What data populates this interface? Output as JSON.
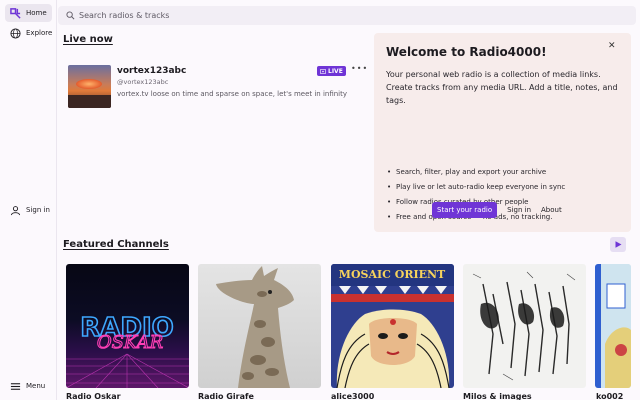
{
  "sidebar": {
    "home_label": "Home",
    "explore_label": "Explore",
    "signin_label": "Sign in",
    "menu_label": "Menu"
  },
  "search": {
    "placeholder": "Search radios & tracks"
  },
  "live": {
    "title": "Live now",
    "channel": {
      "name": "vortex123abc",
      "handle": "@vortex123abc",
      "description": "vortex.tv loose on time and sparse on space, let's meet in infinity",
      "badge": "LIVE",
      "more": "•••"
    }
  },
  "welcome": {
    "title": "Welcome to Radio4000!",
    "close": "✕",
    "intro_1": "Your personal web radio is a collection of media links.",
    "intro_2": "Create tracks from any media URL. Add a title, notes, and tags.",
    "features": [
      "Search, filter, play and export your archive",
      "Play live or let auto-radio keep everyone in sync",
      "Follow radios curated by other people",
      "Free and open source — no ads, no tracking."
    ],
    "start_button": "Start your radio",
    "signin_link": "Sign in",
    "about_link": "About"
  },
  "featured": {
    "title": "Featured Channels",
    "channels": [
      {
        "name": "Radio Oskar"
      },
      {
        "name": "Radio Girafe"
      },
      {
        "name": "alice3000"
      },
      {
        "name": "Milos & images"
      },
      {
        "name": "ko002"
      }
    ]
  },
  "colors": {
    "accent": "#6f35d6",
    "welcome_bg": "#f7eceb",
    "background": "#fcf9fd"
  }
}
